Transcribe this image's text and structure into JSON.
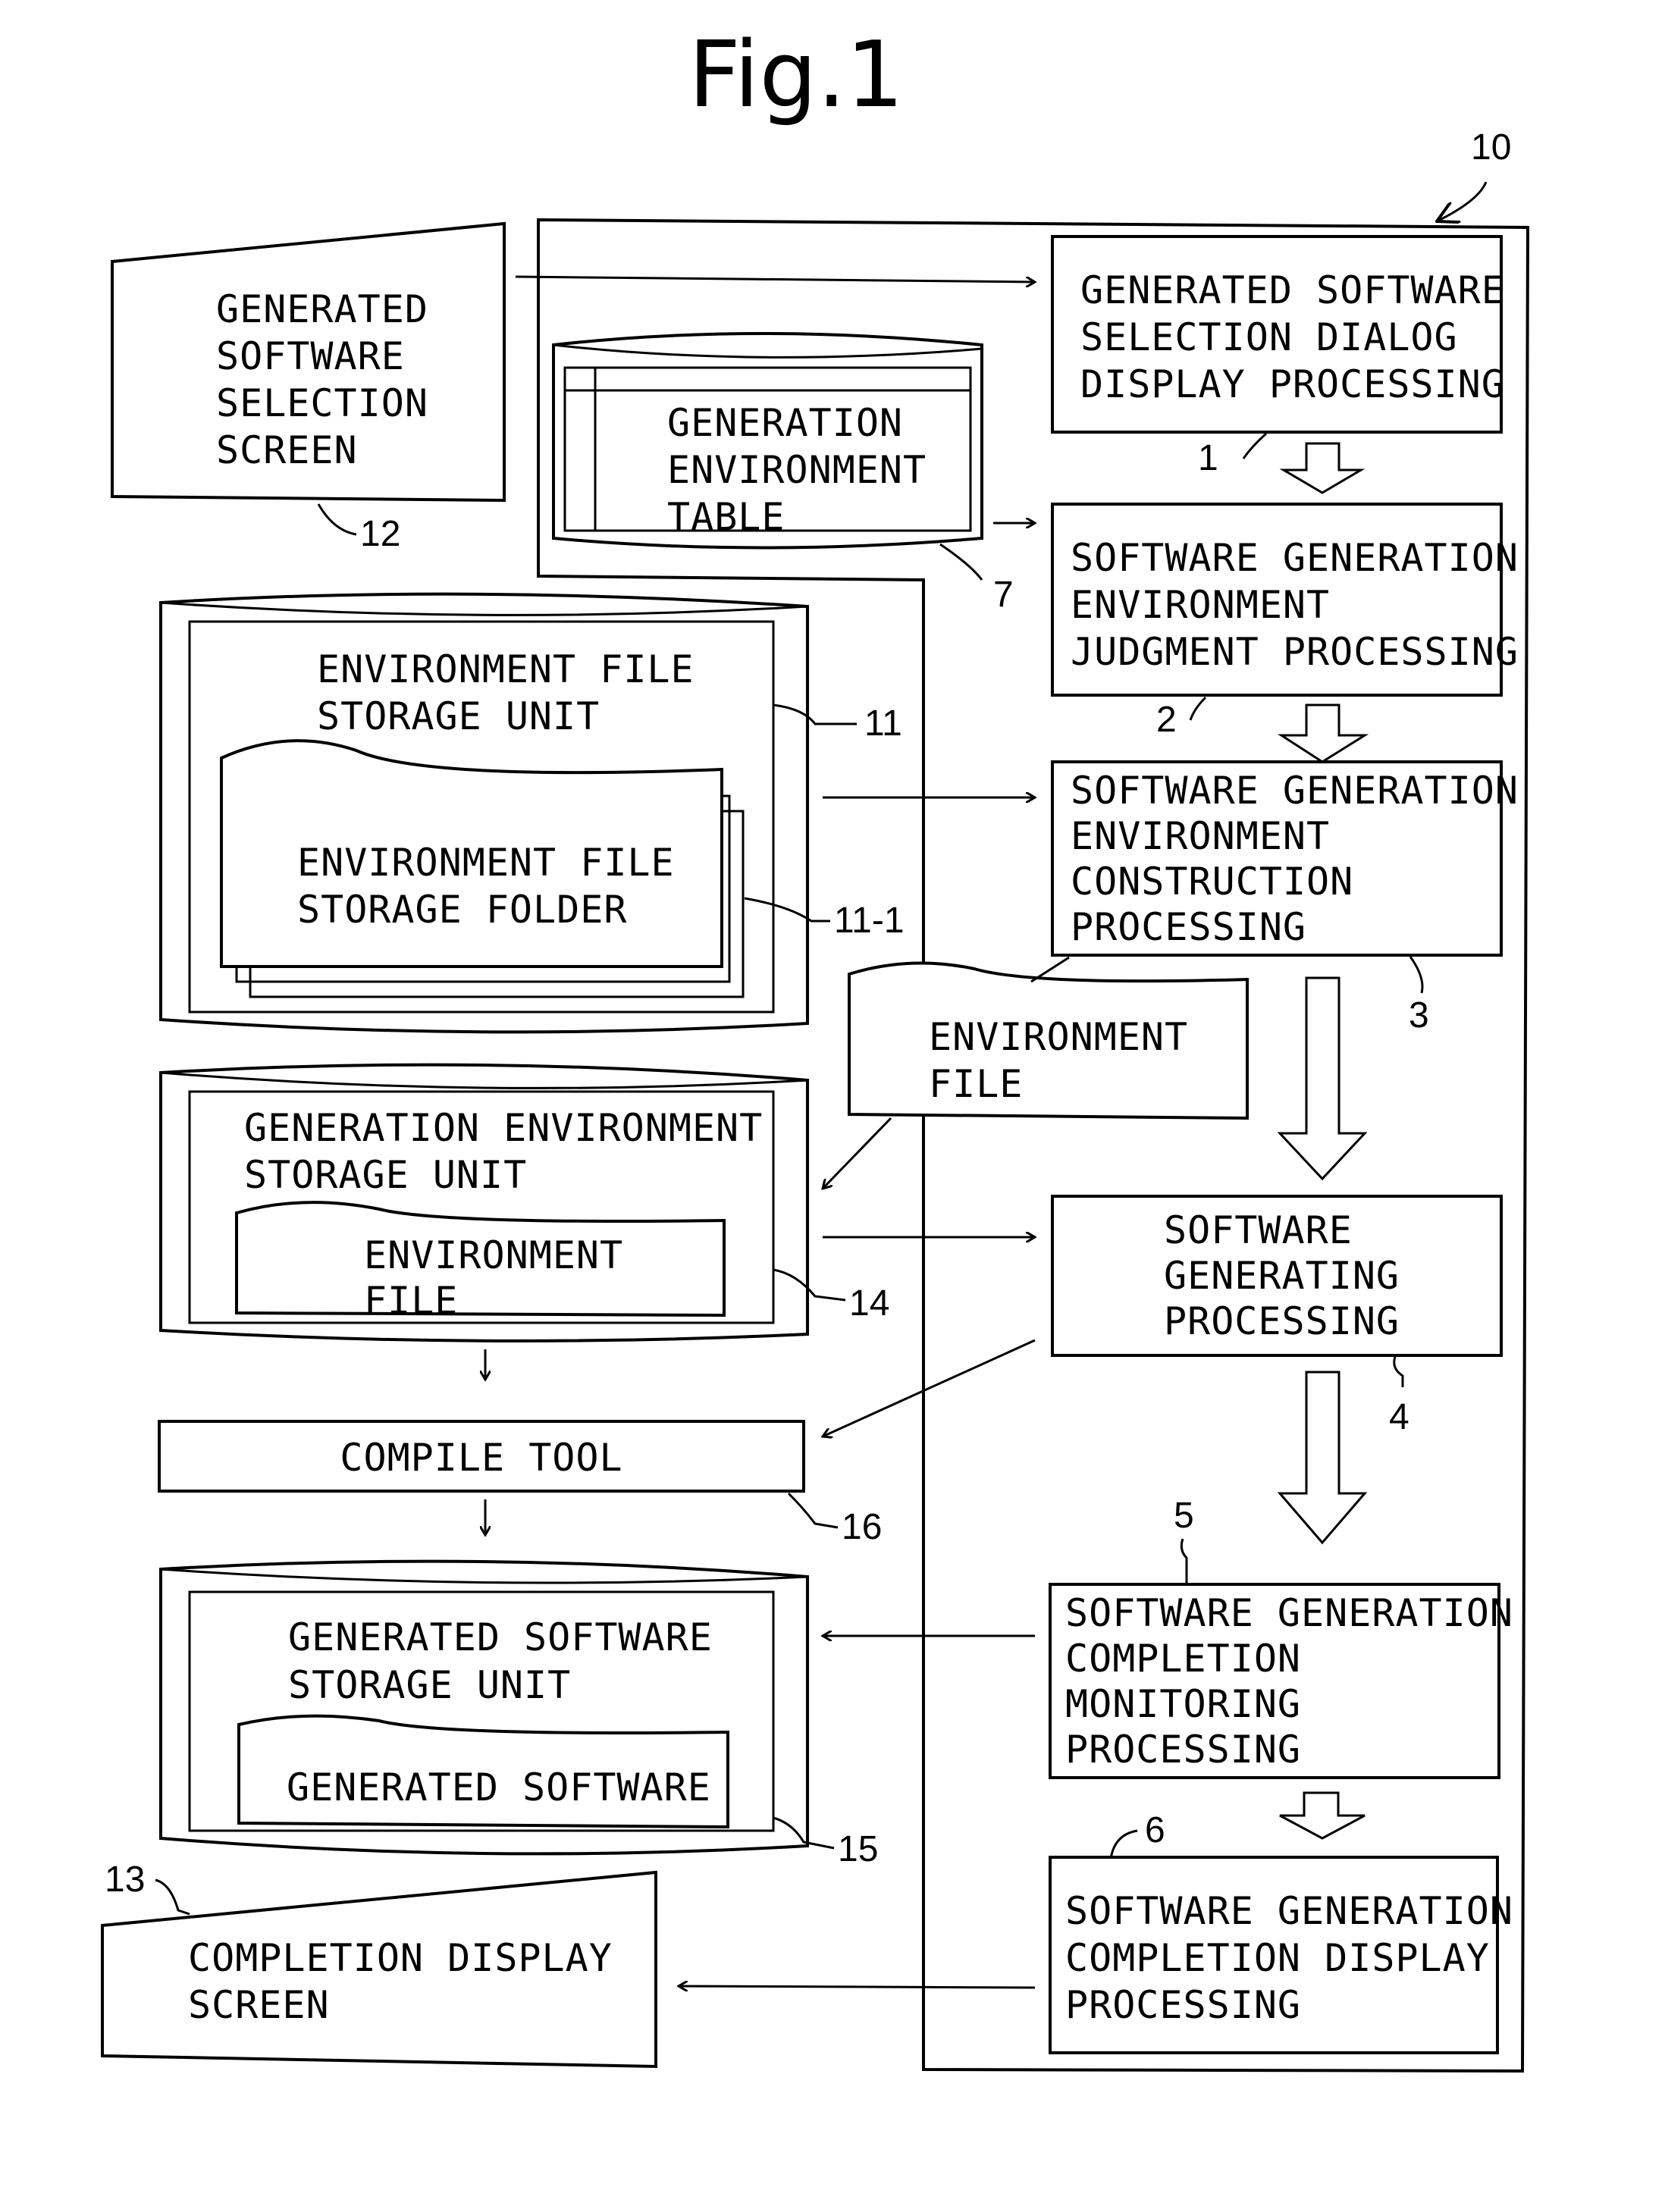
{
  "figure": {
    "title": "Fig.1",
    "system_ref": "10"
  },
  "processes": [
    {
      "id": "p1",
      "ref": "1",
      "lines": [
        "GENERATED SOFTWARE",
        "SELECTION DIALOG",
        "DISPLAY PROCESSING"
      ]
    },
    {
      "id": "p2",
      "ref": "2",
      "lines": [
        "SOFTWARE GENERATION",
        "ENVIRONMENT",
        "JUDGMENT PROCESSING"
      ]
    },
    {
      "id": "p3",
      "ref": "3",
      "lines": [
        "SOFTWARE GENERATION",
        "ENVIRONMENT",
        "CONSTRUCTION",
        "PROCESSING"
      ]
    },
    {
      "id": "p4",
      "ref": "4",
      "lines": [
        "SOFTWARE",
        "GENERATING",
        "PROCESSING"
      ]
    },
    {
      "id": "p5",
      "ref": "5",
      "lines": [
        "SOFTWARE GENERATION",
        "COMPLETION",
        "MONITORING",
        "PROCESSING"
      ]
    },
    {
      "id": "p6",
      "ref": "6",
      "lines": [
        "SOFTWARE GENERATION",
        "COMPLETION DISPLAY",
        "PROCESSING"
      ]
    }
  ],
  "table": {
    "ref": "7",
    "lines": [
      "GENERATION",
      "ENVIRONMENT",
      "TABLE"
    ]
  },
  "screens": {
    "selection": {
      "ref": "12",
      "lines": [
        "GENERATED",
        "SOFTWARE",
        "SELECTION",
        "SCREEN"
      ]
    },
    "completion": {
      "ref": "13",
      "lines": [
        "COMPLETION DISPLAY",
        "SCREEN"
      ]
    }
  },
  "storages": {
    "env_file_storage": {
      "ref": "11",
      "lines": [
        "ENVIRONMENT FILE",
        "STORAGE UNIT"
      ],
      "folder": {
        "ref": "11-1",
        "lines": [
          "ENVIRONMENT FILE",
          "STORAGE FOLDER"
        ]
      }
    },
    "gen_env_storage": {
      "ref": "14",
      "lines": [
        "GENERATION ENVIRONMENT",
        "STORAGE UNIT"
      ],
      "file": {
        "lines": [
          "ENVIRONMENT",
          "FILE"
        ]
      }
    },
    "gen_sw_storage": {
      "ref": "15",
      "lines": [
        "GENERATED SOFTWARE",
        "STORAGE UNIT"
      ],
      "file": {
        "lines": [
          "GENERATED SOFTWARE"
        ]
      }
    }
  },
  "env_file": {
    "lines": [
      "ENVIRONMENT",
      "FILE"
    ]
  },
  "compile_tool": {
    "ref": "16",
    "label": "COMPILE TOOL"
  }
}
